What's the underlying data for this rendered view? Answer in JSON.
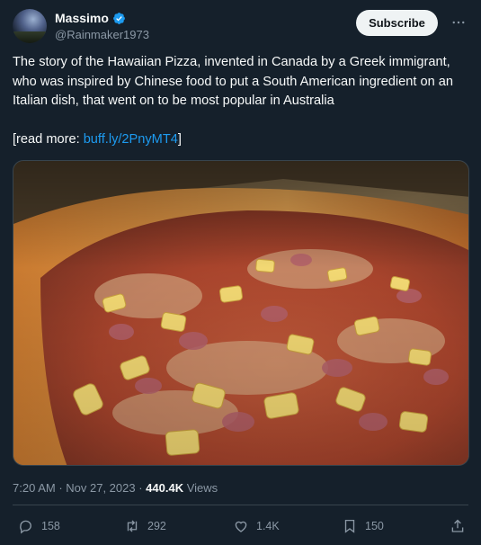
{
  "author": {
    "display_name": "Massimo",
    "handle": "@Rainmaker1973"
  },
  "subscribe_label": "Subscribe",
  "tweet": {
    "text": "The story of the Hawaiian Pizza, invented in Canada by a Greek immigrant, who was inspired by Chinese food to put a South American ingredient on an Italian dish, that went on to be most popular in Australia",
    "read_more_prefix": "[read more: ",
    "link_text": "buff.ly/2PnyMT4",
    "read_more_suffix": "]"
  },
  "meta": {
    "time": "7:20 AM",
    "separator1": " · ",
    "date": "Nov 27, 2023",
    "separator2": " · ",
    "views_count": "440.4K",
    "views_label": " Views"
  },
  "actions": {
    "replies": "158",
    "reposts": "292",
    "likes": "1.4K",
    "bookmarks": "150"
  },
  "colors": {
    "background": "#15202b",
    "accent": "#1d9bf0",
    "muted": "#8b98a5",
    "verified": "#1d9bf0"
  },
  "icons": [
    "verified-badge-icon",
    "more-icon",
    "reply-icon",
    "repost-icon",
    "like-icon",
    "bookmark-icon",
    "share-icon"
  ]
}
